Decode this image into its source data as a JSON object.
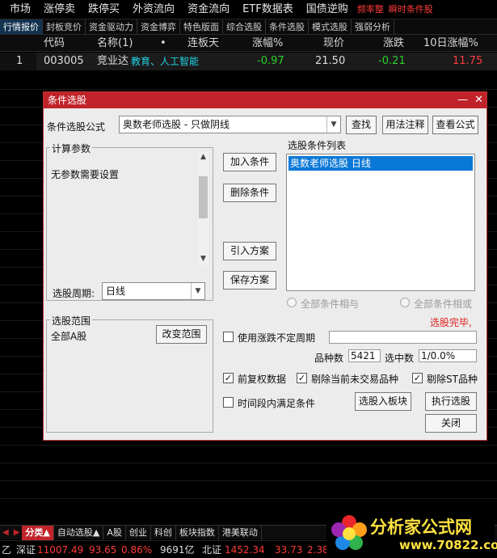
{
  "menubar": {
    "items": [
      "市场",
      "涨停卖",
      "跌停买",
      "外资流向",
      "资金流向",
      "ETF数据表",
      "国债逆购"
    ],
    "red_items": [
      "频率整",
      "瞬时条件股"
    ]
  },
  "subtabs": [
    "行情报价",
    "封板竞价",
    "资金驱动力",
    "资金博弈",
    "特色版面",
    "综合选股",
    "条件选股",
    "模式选股",
    "强弱分析"
  ],
  "quote_table": {
    "headers": [
      "代码",
      "名称(1)",
      "•",
      "连板天",
      "涨幅%",
      "现价",
      "涨跌",
      "10日涨幅%"
    ],
    "rows": [
      {
        "index": "1",
        "code": "003005",
        "name": "竞业达",
        "tag": "教育、人工智能",
        "change_pct": "-0.97",
        "price": "21.50",
        "change": "-0.21",
        "ten_day_pct": "11.75"
      }
    ]
  },
  "dialog": {
    "title": "条件选股",
    "formula_label": "条件选股公式",
    "formula_value": "奥数老师选股  -  只做阴线",
    "buttons": {
      "find": "查找",
      "usage": "用法注释",
      "view_formula": "查看公式",
      "add": "加入条件",
      "delete": "删除条件",
      "import": "引入方案",
      "save": "保存方案",
      "change_range": "改变范围",
      "to_board": "选股入板块",
      "run": "执行选股",
      "close": "关闭"
    },
    "params_group": "计算参数",
    "params_text": "无参数需要设置",
    "period_label": "选股周期:",
    "period_value": "日线",
    "range_group": "选股范围",
    "range_value": "全部A股",
    "cond_list_label": "选股条件列表",
    "cond_list_items": [
      "奥数老师选股  日线"
    ],
    "radio_and": "全部条件相与",
    "radio_or": "全部条件相或",
    "status": "选股完毕,",
    "use_unsettled": "使用涨跌不定周期",
    "count_label": "品种数",
    "count_value": "5421",
    "selected_label": "选中数",
    "selected_value": "1/0.0%",
    "chk_fq": "前复权数据",
    "chk_notrade": "剔除当前未交易品种",
    "chk_st": "剔除ST品种",
    "chk_period": "时间段内满足条件"
  },
  "bottom_tabs": [
    "分类▲",
    "自动选股▲",
    "A股",
    "创业",
    "科创",
    "板块指数",
    "港美联动"
  ],
  "status_bar": {
    "left": "乙",
    "sz_label": "深证",
    "sz_value": "11007.49",
    "sz_change": "93.65",
    "sz_pct": "0.86%",
    "sz_amount": "9691亿",
    "bz_label": "北证",
    "bz_value": "1452.34",
    "bz_change": "33.73",
    "bz_pct": "2.38"
  },
  "logo": {
    "text": "分析家公式网",
    "url": "www.70822.com"
  },
  "colors": {
    "up": "#ff3b3b",
    "down": "#2bd12b",
    "accent": "#c0242a",
    "selection": "#0a78d7"
  }
}
